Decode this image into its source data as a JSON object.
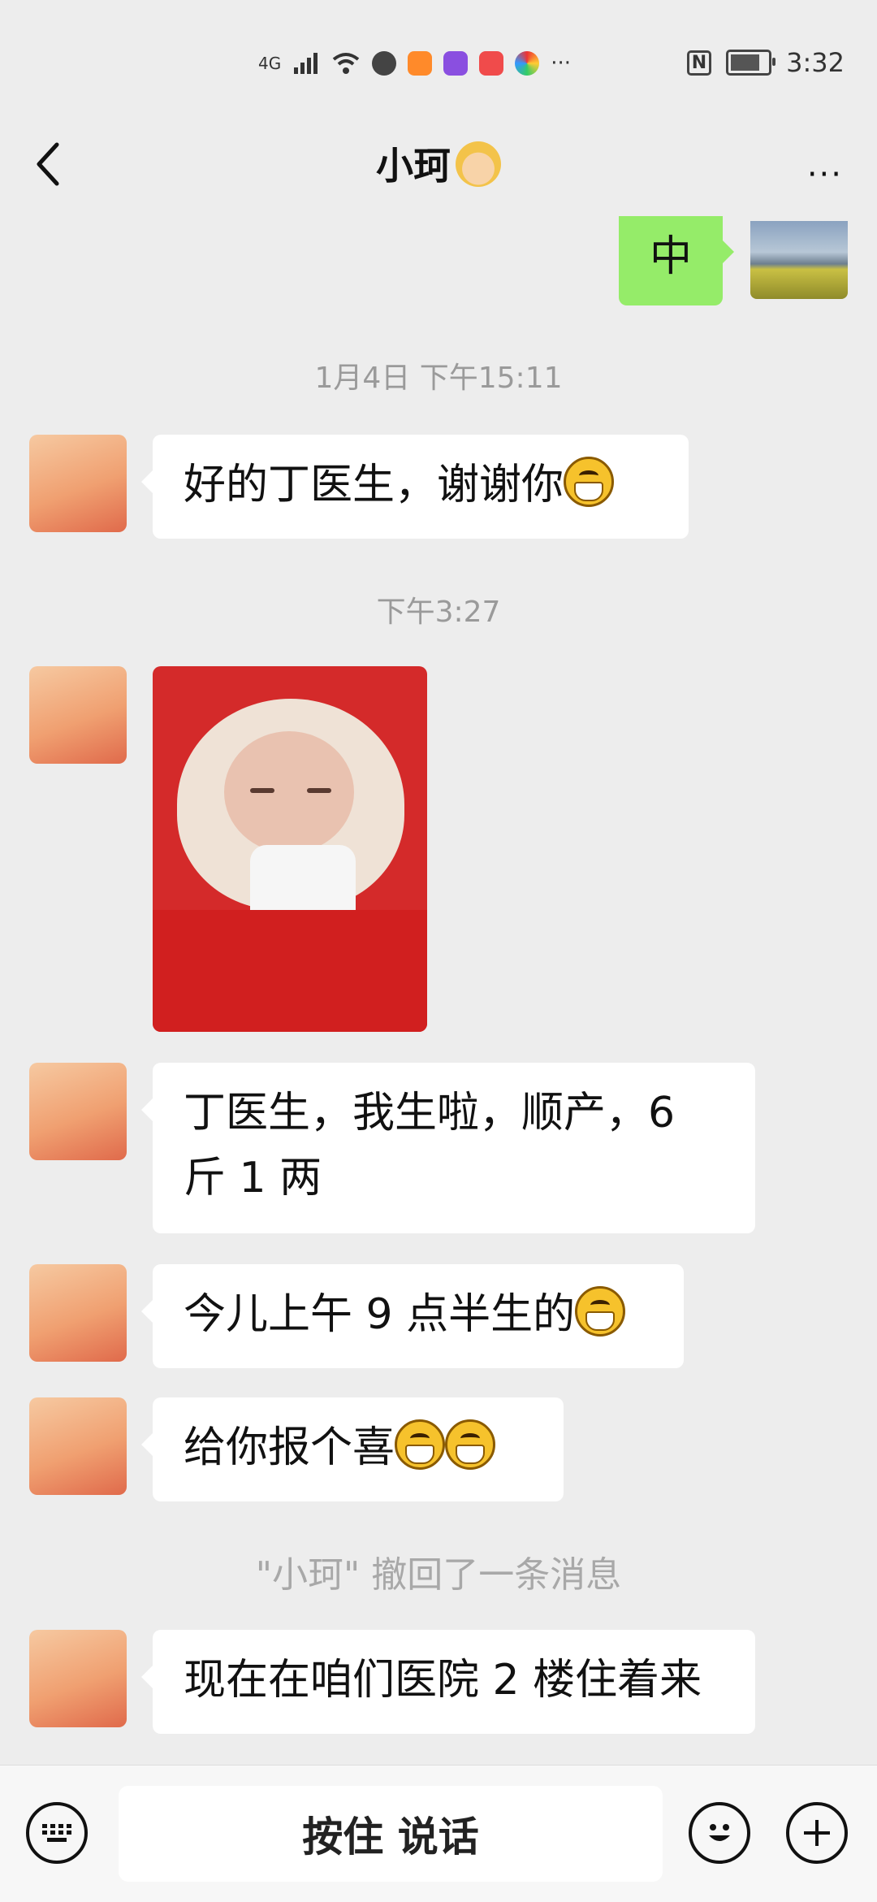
{
  "status_bar": {
    "network": "4G",
    "time": "3:32",
    "nfc": "N",
    "more": "···",
    "icons": [
      "wifi-icon",
      "aperture-icon",
      "video-play-icon",
      "butterfly-icon",
      "reader-icon",
      "palette-icon"
    ]
  },
  "header": {
    "title": "小珂",
    "more": "···"
  },
  "messages": {
    "m0_text": "中",
    "time1": "1月4日 下午15:11",
    "m1_text": "好的丁医生，谢谢你",
    "time2": "下午3:27",
    "m3_line1": "丁医生，我生啦，顺产，6",
    "m3_line2": "斤 1 两",
    "m4_text": "今儿上午 9 点半生的",
    "m5_text": "给你报个喜",
    "recall_text": "\"小珂\" 撤回了一条消息",
    "m6_text": "现在在咱们医院 2 楼住着来"
  },
  "input_bar": {
    "hold_to_talk": "按住 说话"
  },
  "colors": {
    "background": "#ededed",
    "sent_bubble": "#95ec69",
    "received_bubble": "#ffffff",
    "time_text": "#9a9a9a"
  }
}
